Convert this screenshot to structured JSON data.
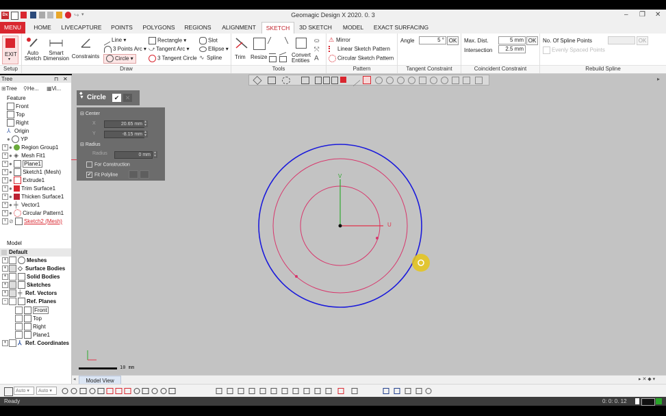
{
  "app": {
    "title": "Geomagic Design X 2020. 0. 3",
    "logo_text": "Dx"
  },
  "tabs": [
    {
      "label": "MENU"
    },
    {
      "label": "HOME"
    },
    {
      "label": "LIVECAPTURE"
    },
    {
      "label": "POINTS"
    },
    {
      "label": "POLYGONS"
    },
    {
      "label": "REGIONS"
    },
    {
      "label": "ALIGNMENT"
    },
    {
      "label": "SKETCH"
    },
    {
      "label": "3D SKETCH"
    },
    {
      "label": "MODEL"
    },
    {
      "label": "EXACT SURFACING"
    }
  ],
  "ribbon": {
    "setup": {
      "exit": "EXIT",
      "auto_sketch": "Auto\nSketch",
      "smart_dimension": "Smart\nDimension",
      "label": "Setup"
    },
    "draw": {
      "constraints": "Constraints",
      "line": "Line",
      "three_points_arc": "3 Points Arc",
      "circle": "Circle",
      "rectangle": "Rectangle",
      "tangent_arc": "Tangent Arc",
      "three_tangent_circle": "3 Tangent Circle",
      "slot": "Slot",
      "ellipse": "Ellipse",
      "spline": "Spline",
      "label": "Draw"
    },
    "tools": {
      "trim": "Trim",
      "resize": "Resize",
      "convert_entities": "Convert\nEntities",
      "label": "Tools"
    },
    "pattern": {
      "mirror": "Mirror",
      "linear": "Linear Sketch Pattern",
      "circular": "Circular Sketch Pattern",
      "label": "Pattern"
    },
    "tangent_constraint": {
      "angle_label": "Angle",
      "angle_value": "5 °",
      "ok": "OK",
      "label": "Tangent Constraint"
    },
    "coincident_constraint": {
      "max_dist_label": "Max. Dist.",
      "max_dist_value": "5 mm",
      "intersection_label": "Intersection",
      "intersection_value": "2.5 mm",
      "ok": "OK",
      "label": "Coincident Constraint"
    },
    "rebuild_spline": {
      "num_points_label": "No. Of Spline Points",
      "evenly_spaced": "Evenly Spaced Points",
      "ok": "OK",
      "label": "Rebuild Spline"
    }
  },
  "tree_panel": {
    "title": "Tree",
    "subtabs": [
      "Tree",
      "He...",
      "Vi..."
    ],
    "feature_header": "Feature",
    "features": [
      {
        "label": "Front"
      },
      {
        "label": "Top"
      },
      {
        "label": "Right"
      },
      {
        "label": "Origin"
      },
      {
        "label": "YP"
      },
      {
        "label": "Region Group1"
      },
      {
        "label": "Mesh Fit1"
      },
      {
        "label": "Plane1"
      },
      {
        "label": "Sketch1 (Mesh)"
      },
      {
        "label": "Extrude1"
      },
      {
        "label": "Trim Surface1"
      },
      {
        "label": "Thicken Surface1"
      },
      {
        "label": "Vector1"
      },
      {
        "label": "Circular Pattern1"
      },
      {
        "label": "Sketch2 (Mesh)"
      }
    ],
    "model_header": "Model",
    "model_items": [
      {
        "label": "Default"
      },
      {
        "label": "Meshes"
      },
      {
        "label": "Surface Bodies"
      },
      {
        "label": "Solid Bodies"
      },
      {
        "label": "Sketches"
      },
      {
        "label": "Ref. Vectors"
      },
      {
        "label": "Ref. Planes"
      },
      {
        "label": "Front"
      },
      {
        "label": "Top"
      },
      {
        "label": "Right"
      },
      {
        "label": "Plane1"
      },
      {
        "label": "Ref. Coordinates"
      }
    ]
  },
  "circle_dialog": {
    "title": "Circle",
    "center_header": "Center",
    "x_label": "X",
    "x_value": "20.65 mm",
    "y_label": "Y",
    "y_value": "-8.15 mm",
    "radius_header": "Radius",
    "radius_label": "Radius",
    "radius_value": "0 mm",
    "for_construction": "For Construction",
    "fit_polyline": "Fit Polyline"
  },
  "viewport": {
    "axis_u": "U",
    "axis_v": "V",
    "scale_label": "10 mm",
    "colors": {
      "blue_circle": "#1a1adb",
      "pink_circle": "#d8356b",
      "axis_green": "#2ea82e",
      "axis_red": "#e0334a",
      "cursor_highlight": "#e6c619"
    }
  },
  "bottom": {
    "view_tab": "Model View",
    "auto1": "Auto",
    "auto2": "Auto",
    "status": "Ready",
    "time": "0: 0: 0. 12"
  }
}
